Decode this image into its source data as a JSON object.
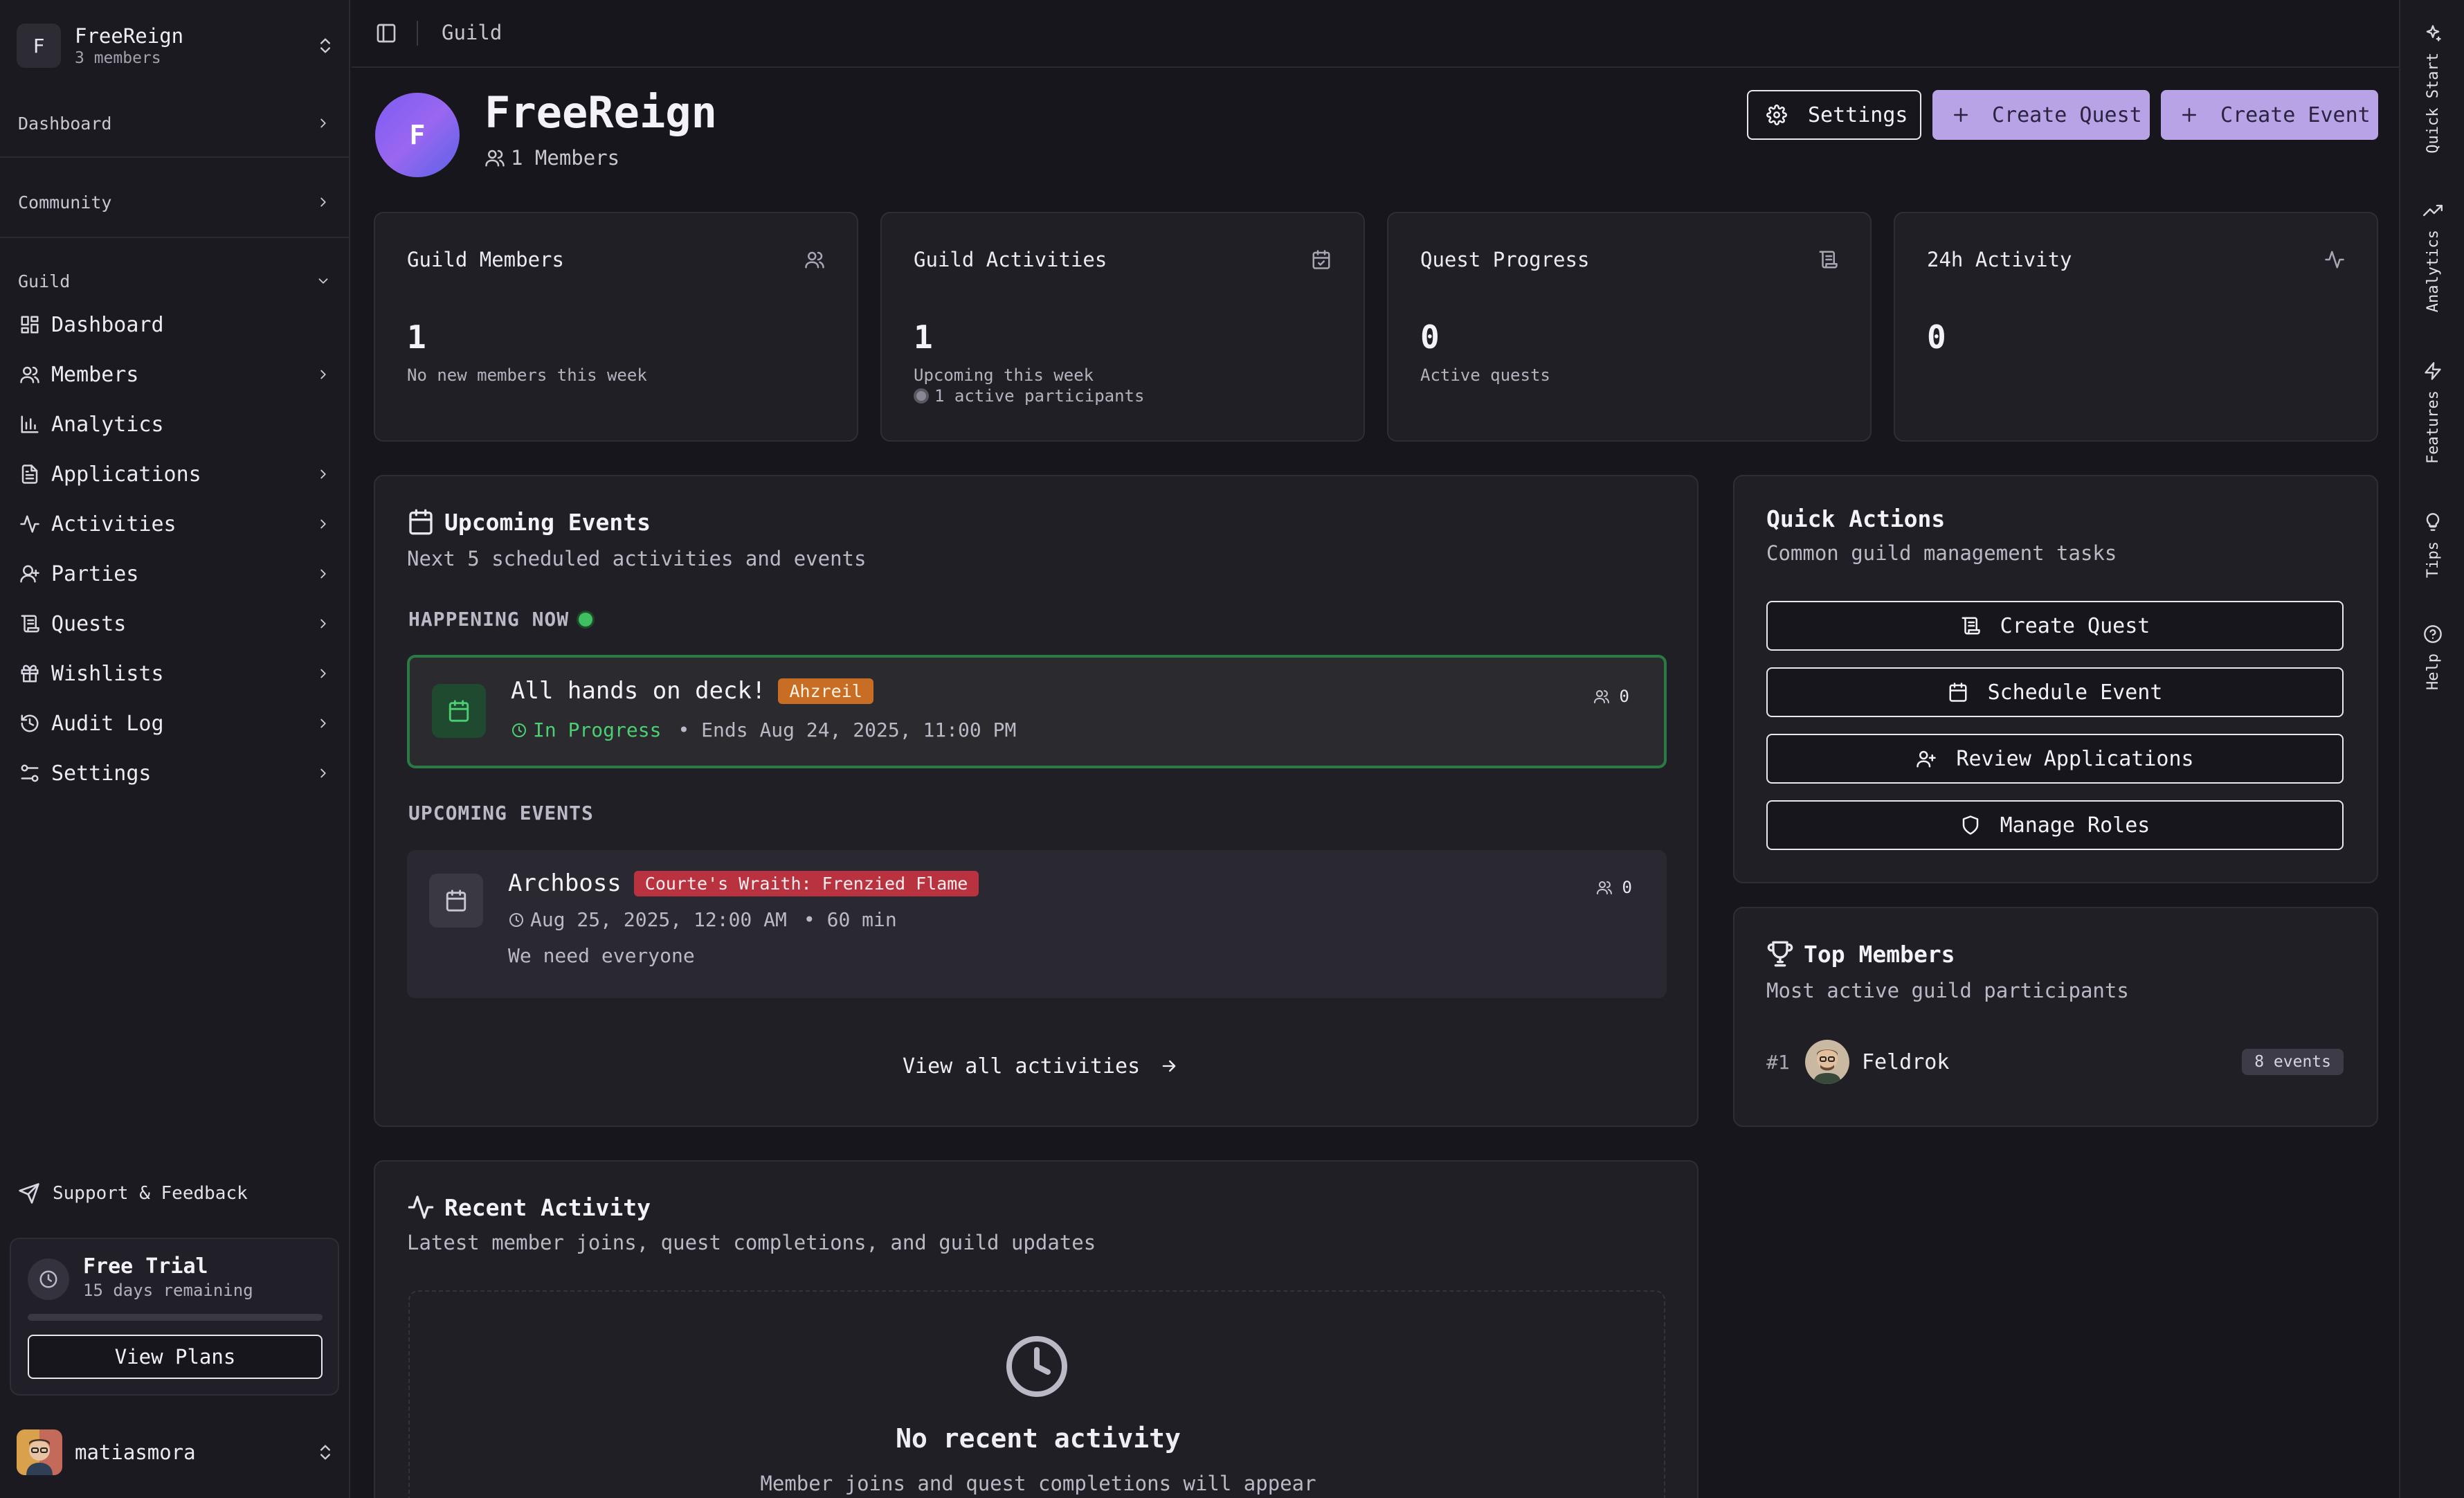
{
  "workspace": {
    "initial": "F",
    "name": "FreeReign",
    "members": "3 members"
  },
  "sidebar": {
    "sections": {
      "dashboard": "Dashboard",
      "community": "Community",
      "guild": "Guild"
    },
    "items": [
      {
        "label": "Dashboard",
        "icon": "grid-icon"
      },
      {
        "label": "Members",
        "icon": "users-icon"
      },
      {
        "label": "Analytics",
        "icon": "bar-chart-icon"
      },
      {
        "label": "Applications",
        "icon": "file-text-icon"
      },
      {
        "label": "Activities",
        "icon": "activity-icon"
      },
      {
        "label": "Parties",
        "icon": "user-group-icon"
      },
      {
        "label": "Quests",
        "icon": "scroll-icon"
      },
      {
        "label": "Wishlists",
        "icon": "gift-icon"
      },
      {
        "label": "Audit Log",
        "icon": "history-icon"
      },
      {
        "label": "Settings",
        "icon": "sliders-icon"
      }
    ],
    "support": "Support & Feedback",
    "trial": {
      "title": "Free Trial",
      "remaining": "15 days remaining",
      "progress": 0.0,
      "cta": "View Plans"
    },
    "user": {
      "name": "matiasmora"
    }
  },
  "header": {
    "breadcrumb": "Guild"
  },
  "guild": {
    "initial": "F",
    "name": "FreeReign",
    "members": "1 Members",
    "buttons": {
      "settings": "Settings",
      "create_quest": "Create Quest",
      "create_event": "Create Event"
    }
  },
  "stats": [
    {
      "title": "Guild Members",
      "value": "1",
      "sub": "No new members this week",
      "icon": "users-icon"
    },
    {
      "title": "Guild Activities",
      "value": "1",
      "sub": "Upcoming this week",
      "sub2": "1 active participants",
      "icon": "calendar-check-icon"
    },
    {
      "title": "Quest Progress",
      "value": "0",
      "sub": "Active quests",
      "icon": "scroll-icon"
    },
    {
      "title": "24h Activity",
      "value": "0",
      "sub": "",
      "icon": "activity-icon"
    }
  ],
  "events": {
    "title": "Upcoming Events",
    "desc": "Next 5 scheduled activities and events",
    "happening_label": "HAPPENING NOW",
    "upcoming_label": "UPCOMING EVENTS",
    "current": {
      "title": "All hands on deck!",
      "tag": "Ahzreil",
      "status": "In Progress",
      "ends": "• Ends Aug 24, 2025, 11:00 PM",
      "count": "0"
    },
    "next": {
      "title": "Archboss",
      "tag": "Courte's Wraith: Frenzied Flame",
      "date": "Aug 25, 2025, 12:00 AM",
      "duration": "• 60 min",
      "note": "We need everyone",
      "count": "0"
    },
    "view_all": "View all activities"
  },
  "quick_actions": {
    "title": "Quick Actions",
    "desc": "Common guild management tasks",
    "buttons": [
      "Create Quest",
      "Schedule Event",
      "Review Applications",
      "Manage Roles"
    ]
  },
  "top_members": {
    "title": "Top Members",
    "desc": "Most active guild participants",
    "list": [
      {
        "rank": "#1",
        "name": "Feldrok",
        "badge": "8 events"
      }
    ]
  },
  "recent": {
    "title": "Recent Activity",
    "desc": "Latest member joins, quest completions, and guild updates",
    "empty_title": "No recent activity",
    "empty_desc": "Member joins and quest completions will appear"
  },
  "rail": [
    "Quick Start",
    "Analytics",
    "Features",
    "Tips",
    "Help"
  ],
  "colors": {
    "accent": "#b7a3e6",
    "live": "#3fbf5f",
    "tag_orange": "#c86e24",
    "tag_red": "#b8333f",
    "background": "#17161c"
  }
}
